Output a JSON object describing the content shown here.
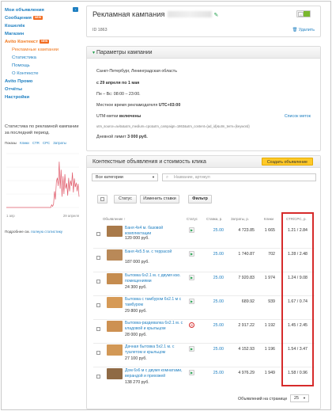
{
  "sidebar": {
    "items": [
      {
        "label": "Мои объявления",
        "level": 0
      },
      {
        "label": "Сообщения",
        "level": 0,
        "badge": "NEW"
      },
      {
        "label": "Кошелёк",
        "level": 0
      },
      {
        "label": "Магазин",
        "level": 0
      },
      {
        "label": "Avito Контекст",
        "level": 0,
        "badge": "NEW",
        "active": true
      },
      {
        "label": "Рекламные кампании",
        "level": 1,
        "active": true
      },
      {
        "label": "Статистика",
        "level": 1
      },
      {
        "label": "Помощь",
        "level": 1
      },
      {
        "label": "О Контексте",
        "level": 1
      },
      {
        "label": "Avito Промо",
        "level": 0
      },
      {
        "label": "Отчёты",
        "level": 0
      },
      {
        "label": "Настройки",
        "level": 0
      }
    ],
    "stats_caption": "Статистика по рекламной кампании за последний период.",
    "stats_tabs": {
      "label": "Показы",
      "clicks": "Клики",
      "ctr": "CTR",
      "cpc": "CPC",
      "spend": "Затраты"
    },
    "chart_x_start": "1 апр",
    "chart_x_end": "29 апреля",
    "more_text": "Подробнее см.",
    "more_link": "полную статистику"
  },
  "campaign": {
    "title": "Рекламная кампания",
    "id_text": "ID 1863",
    "delete_label": "Удалить"
  },
  "params": {
    "header": "Параметры кампании",
    "region": "Санкт-Петербург, Ленинградская область",
    "dates": "с 29 апреля по 1 мая",
    "schedule": "Пн – Вс: 08:00 – 23:00.",
    "timezone_label": "Местное время рекламодателя",
    "timezone_value": "UTC+03:00",
    "utm_label": "UTM-метки",
    "utm_value": "включены",
    "keys_link": "Список меток",
    "utm_string": "utm_source=avito&utm_medium=cpc&utm_campaign=1863&utm_content={ad_id}&utm_term={keyword}",
    "limit_label": "Дневной лимит",
    "limit_value": "3 000 руб."
  },
  "ads": {
    "header": "Контекстные объявления и стоимость клика",
    "create_button": "Создать объявление",
    "category_select": "Все категории",
    "search_placeholder": "Название, артикул",
    "status_button": "Статус",
    "change_rates_button": "Изменить ставки",
    "filter_button": "Фильтр",
    "columns": [
      "Объявление ↑",
      "Статус",
      "Ставка, р.",
      "Затраты, р.",
      "Клики",
      "CTR/CPC, р."
    ],
    "rows": [
      {
        "name": "Баня 4х4 м. базовой комплектации",
        "price": "120 000 руб.",
        "status": "play",
        "rate": "25.00",
        "spend": "4 723.85",
        "clicks": "1 665",
        "ctr_cpc": "1.21 / 2.84",
        "thumb": "#a97a4a"
      },
      {
        "name": "Баня 4х5.5 м. с террасой",
        "price": "187 000 руб.",
        "status": "play",
        "rate": "25.00",
        "spend": "1 740.87",
        "clicks": "702",
        "ctr_cpc": "1.28 / 2.48",
        "thumb": "#b98958"
      },
      {
        "name": "Бытовка 6х2.1 м. с двумя изо. помещениями",
        "price": "24 300 руб.",
        "status": "play",
        "rate": "25.00",
        "spend": "7 920.83",
        "clicks": "1 974",
        "ctr_cpc": "1.24 / 9.08",
        "thumb": "#c58c4f"
      },
      {
        "name": "Бытовка с тамбуром 6х2.1 м с тамбуром",
        "price": "29 800 руб.",
        "status": "play",
        "rate": "25.00",
        "spend": "689.92",
        "clicks": "939",
        "ctr_cpc": "1.67 / 0.74",
        "thumb": "#d69a56"
      },
      {
        "name": "Бытовка-раздевалка 6х2.1 м. с кладовой и крыльцом",
        "price": "28 000 руб.",
        "status": "stop",
        "rate": "25.00",
        "spend": "2 917.22",
        "clicks": "1 192",
        "ctr_cpc": "1.45 / 2.45",
        "thumb": "#cd9152"
      },
      {
        "name": "Дачная бытовка 5х2.1 м. с туалетом и крыльцом",
        "price": "27 100 руб.",
        "status": "play",
        "rate": "25.00",
        "spend": "4 152.93",
        "clicks": "1 196",
        "ctr_cpc": "1.54 / 3.47",
        "thumb": "#d29856"
      },
      {
        "name": "Дом 6х6 м с двумя комнатами, верандой и прихожей",
        "price": "138 270 руб.",
        "status": "play",
        "rate": "25.00",
        "spend": "4 976.29",
        "clicks": "1 949",
        "ctr_cpc": "1.58 / 0.96",
        "thumb": "#8f6a45"
      }
    ],
    "per_page_label": "Объявлений на странице",
    "per_page_value": "25"
  },
  "chart_data": {
    "type": "line",
    "title": "",
    "xlabel": "",
    "ylabel": "",
    "x_start": "1 апр",
    "x_end": "29 апреля",
    "series": [
      {
        "values": [
          0,
          0,
          0,
          0,
          0,
          0,
          0,
          0,
          0,
          0,
          0,
          0,
          0,
          0,
          0,
          0,
          0,
          0,
          0,
          0,
          0,
          0,
          0,
          0,
          0,
          0,
          0,
          0,
          0,
          0,
          0,
          0,
          0,
          0,
          0,
          0,
          0,
          0,
          0,
          0,
          0,
          0,
          0,
          0,
          0,
          0,
          0,
          0,
          5,
          2,
          6,
          30,
          15,
          48,
          55,
          40,
          85,
          35,
          70,
          20,
          58,
          25,
          62,
          35,
          45,
          22,
          55,
          30,
          50,
          40,
          65,
          28,
          54,
          38,
          46,
          30,
          44,
          20
        ]
      }
    ],
    "ylim": [
      0,
      100
    ],
    "color": "#e05a6a",
    "grid": true
  }
}
